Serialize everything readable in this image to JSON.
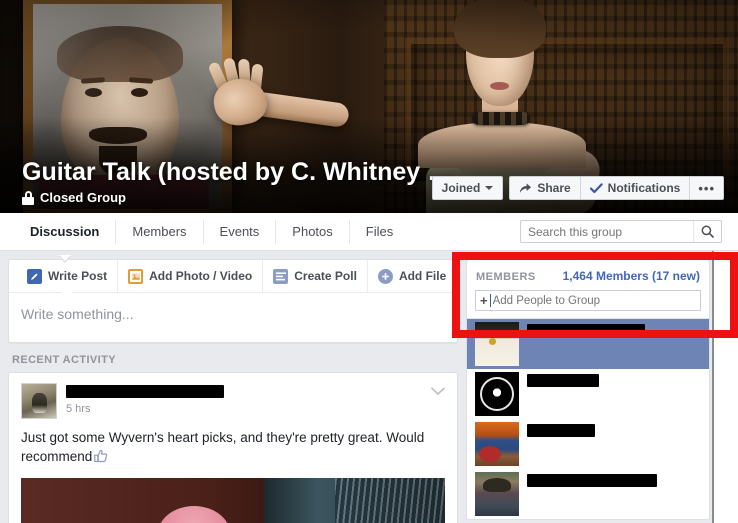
{
  "cover": {
    "group_name": "Guitar Talk (hosted by C. Whitney …",
    "privacy_label": "Closed Group",
    "lock_icon": "lock-icon",
    "actions": {
      "joined_label": "Joined",
      "joined_caret": "caret-down-icon",
      "share_label": "Share",
      "share_icon": "share-arrow-icon",
      "notifications_label": "Notifications",
      "notifications_icon": "checkmark-icon",
      "more_label": "•••",
      "more_icon": "ellipsis-icon"
    }
  },
  "tabbar": {
    "tabs": [
      {
        "label": "Discussion",
        "active": true
      },
      {
        "label": "Members",
        "active": false
      },
      {
        "label": "Events",
        "active": false
      },
      {
        "label": "Photos",
        "active": false
      },
      {
        "label": "Files",
        "active": false
      }
    ],
    "search": {
      "placeholder": "Search this group",
      "value": "",
      "icon": "search-icon"
    }
  },
  "composer": {
    "tabs": [
      {
        "label": "Write Post",
        "icon": "pencil-icon",
        "active": true
      },
      {
        "label": "Add Photo / Video",
        "icon": "photo-icon",
        "active": false
      },
      {
        "label": "Create Poll",
        "icon": "poll-list-icon",
        "active": false
      },
      {
        "label": "Add File",
        "icon": "plus-circle-icon",
        "active": false
      }
    ],
    "placeholder": "Write something..."
  },
  "feed": {
    "section_label": "RECENT ACTIVITY",
    "post": {
      "author_redacted": true,
      "timestamp": "5 hrs",
      "menu_icon": "chevron-down-icon",
      "text": "Just got some Wyvern's heart picks, and they're pretty great. Would recommend",
      "reaction_icon": "thumbs-up-icon",
      "avatar_icon": "post-author-avatar"
    }
  },
  "sidebar": {
    "members": {
      "title": "MEMBERS",
      "count_label": "1,464 Members (17 new)",
      "add_people_placeholder": "Add People to Group",
      "add_people_value": "",
      "add_icon": "plus-icon",
      "rows": [
        {
          "avatar": "av-cat",
          "selected": true,
          "name_width": 118
        },
        {
          "avatar": "av-logo",
          "selected": false,
          "name_width": 72
        },
        {
          "avatar": "av-guitar",
          "selected": false,
          "name_width": 68
        },
        {
          "avatar": "av-couple",
          "selected": false,
          "name_width": 130
        }
      ]
    }
  },
  "annotation": {
    "shape": "rectangle",
    "color": "#ee1111",
    "target": "members-panel-header"
  },
  "colors": {
    "brand_blue": "#4267b2",
    "selection_blue": "#6d84b4",
    "page_bg": "#e9eaed",
    "card_border": "#dddfe2",
    "muted_text": "#90949c",
    "annotation_red": "#ee1111"
  }
}
